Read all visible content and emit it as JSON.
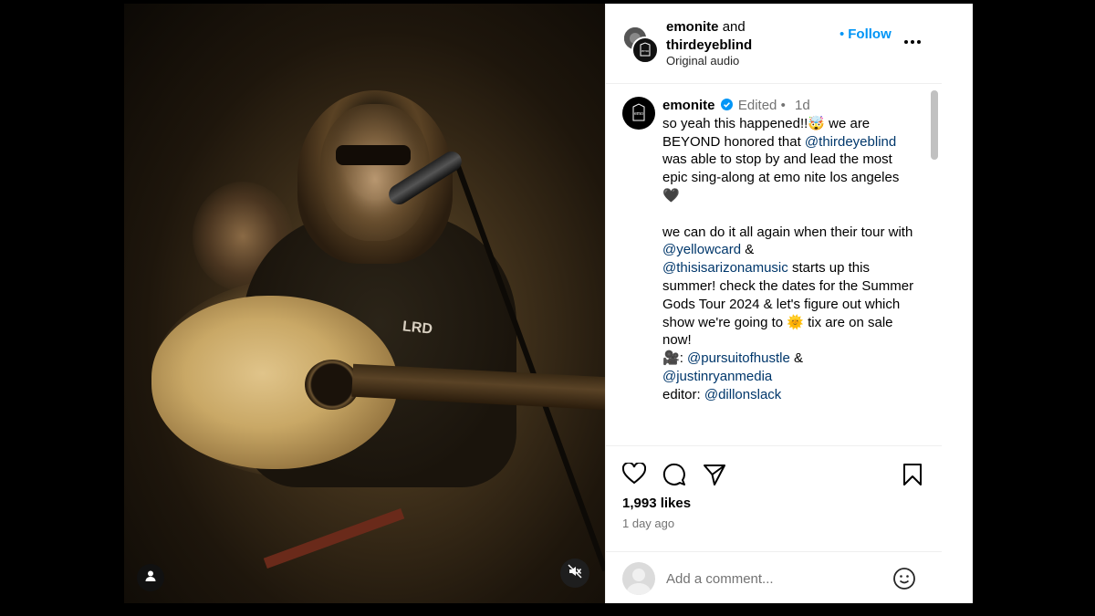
{
  "post": {
    "header": {
      "user1": "emonite",
      "joiner": "and",
      "user2": "thirdeyeblind",
      "audio": "Original audio",
      "follow_label": "Follow",
      "follow_dot": "•"
    },
    "video": {
      "jacket_text": "LRD"
    },
    "caption": {
      "username": "emonite",
      "edited": "Edited",
      "separator": "•",
      "age": "1d",
      "line1": "so yeah this happened!!🤯 we are BEYOND honored that ",
      "mention1": "@thirdeyeblind",
      "line1b": " was able to stop by and lead the most epic sing-along at emo nite los angeles 🖤",
      "line2a": "we can do it all again when their tour with ",
      "mention2": "@yellowcard",
      "line2b": " & ",
      "mention3": "@thisisarizonamusic",
      "line2c": " starts up this summer! check the dates for the Summer Gods Tour 2024 & let's figure out which show we're going to 🌞 tix are on sale now!",
      "camera_emoji": "🎥",
      "camera_colon": ": ",
      "mention4": "@pursuitofhustle",
      "amp": " &",
      "mention5": "@justinryanmedia",
      "editor_label": "editor: ",
      "mention6": "@dillonslack"
    },
    "stats": {
      "likes": "1,993 likes",
      "time_ago": "1 day ago"
    },
    "comment": {
      "placeholder": "Add a comment..."
    }
  },
  "icons": [
    "user-tag-icon",
    "mute-icon",
    "more-icon",
    "verified-icon",
    "heart-icon",
    "comment-icon",
    "share-icon",
    "bookmark-icon",
    "emoji-icon"
  ],
  "colors": {
    "follow": "#0095f6",
    "mention": "#00376b",
    "secondary_text": "#737373",
    "verified": "#0095f6"
  }
}
